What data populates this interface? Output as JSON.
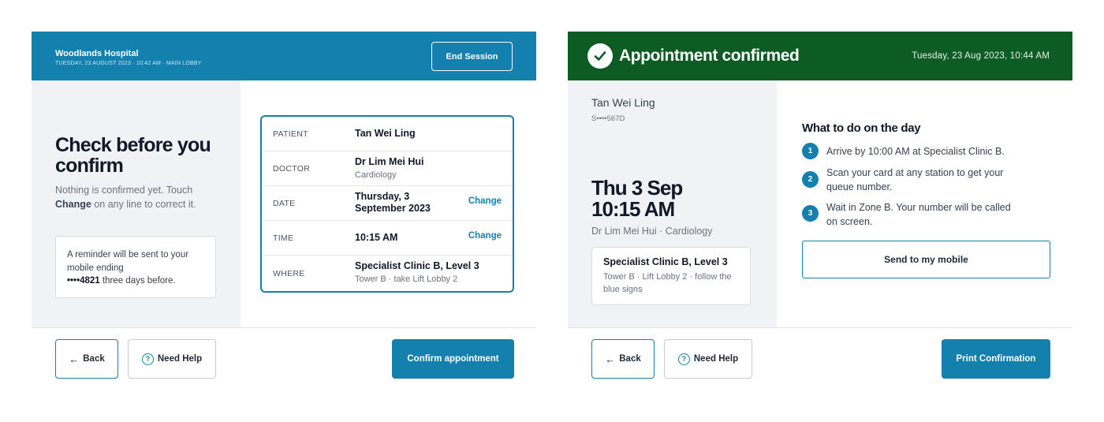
{
  "left_screen": {
    "header": {
      "hospital_name": "Woodlands Hospital",
      "subtitle": "TUESDAY, 23 AUGUST 2023 · 10:42 AM · MAIN LOBBY",
      "end_session_label": "End Session"
    },
    "title": "Check before you confirm",
    "intro_before": "Nothing is confirmed yet. Touch",
    "intro_bold": "Change",
    "intro_after": "on any line to correct it.",
    "reminder_before": "A reminder will be sent to your mobile ending",
    "reminder_bold": "••••4821",
    "reminder_after": "three days before.",
    "details": [
      {
        "label": "PATIENT",
        "value": "Tan Wei Ling",
        "sub": "",
        "change": ""
      },
      {
        "label": "DOCTOR",
        "value": "Dr Lim Mei Hui",
        "sub": "Cardiology",
        "change": ""
      },
      {
        "label": "DATE",
        "value": "Thursday, 3 September 2023",
        "sub": "",
        "change": "Change"
      },
      {
        "label": "TIME",
        "value": "10:15 AM",
        "sub": "",
        "change": "Change"
      },
      {
        "label": "WHERE",
        "value": "Specialist Clinic B, Level 3",
        "sub": "Tower B · take Lift Lobby 2",
        "change": ""
      }
    ],
    "footer": {
      "back_label": "Back",
      "help_label": "Need Help",
      "confirm_label": "Confirm appointment"
    }
  },
  "right_screen": {
    "header": {
      "title": "Appointment confirmed",
      "datetime": "Tuesday, 23 Aug 2023, 10:44 AM"
    },
    "patient_name": "Tan Wei Ling",
    "patient_id": "S••••567D",
    "date_line": "Thu 3 Sep",
    "time_line": "10:15 AM",
    "doctor_line": "Dr Lim Mei Hui · Cardiology",
    "clinic_main": "Specialist Clinic B, Level 3",
    "clinic_sub": "Tower B · Lift Lobby 2 · follow the blue signs",
    "todo_heading": "What to do on the day",
    "steps": [
      {
        "num": "1",
        "text": "Arrive by 10:00 AM at Specialist Clinic B."
      },
      {
        "num": "2",
        "text": "Scan your card at any station to get your queue number."
      },
      {
        "num": "3",
        "text": "Wait in Zone B. Your number will be called on screen."
      }
    ],
    "send_mobile_label": "Send to my mobile",
    "footer": {
      "back_label": "Back",
      "help_label": "Need Help",
      "print_label": "Print Confirmation"
    }
  },
  "colors": {
    "brand_blue": "#1380ad",
    "confirm_green": "#0d5c24",
    "panel_grey": "#f1f2f5"
  }
}
